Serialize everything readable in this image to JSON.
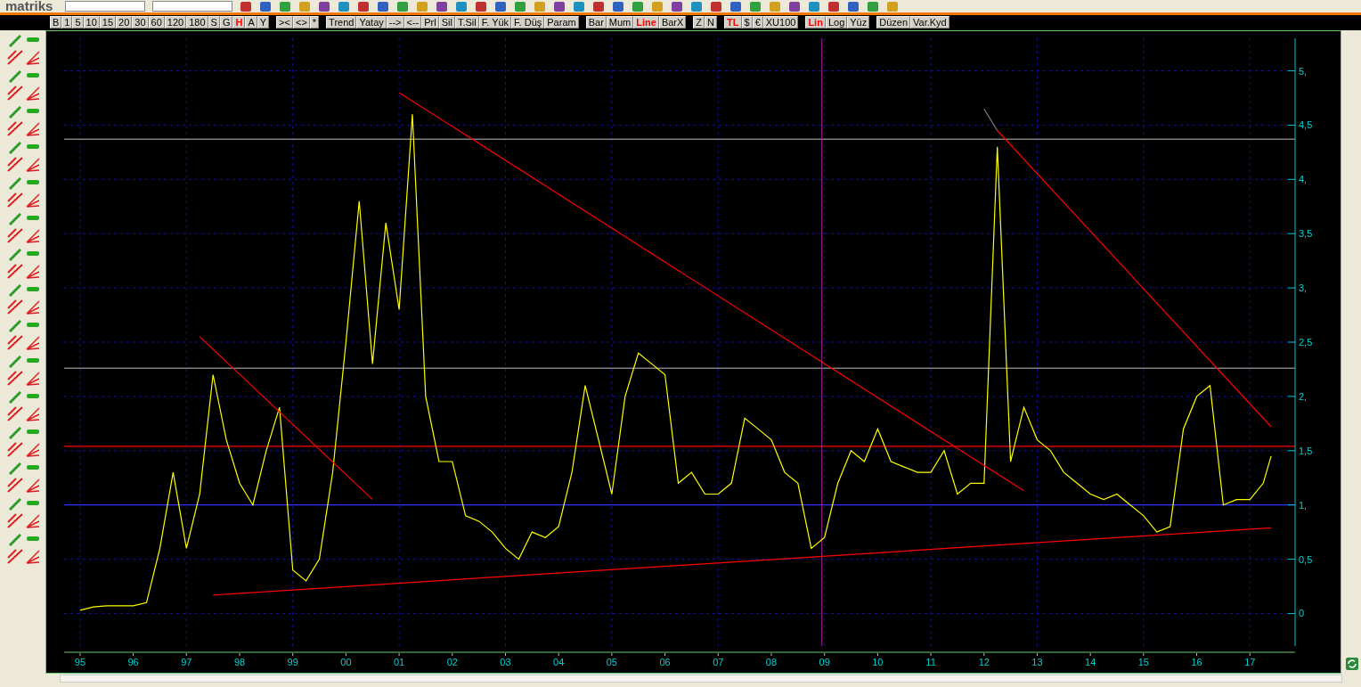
{
  "app": {
    "logo": "matriks"
  },
  "button_groups": [
    {
      "buttons": [
        {
          "label": "B",
          "selected": false
        },
        {
          "label": "1",
          "selected": false
        },
        {
          "label": "5",
          "selected": false
        },
        {
          "label": "10",
          "selected": false
        },
        {
          "label": "15",
          "selected": false
        },
        {
          "label": "20",
          "selected": false
        },
        {
          "label": "30",
          "selected": false
        },
        {
          "label": "60",
          "selected": false
        },
        {
          "label": "120",
          "selected": false
        },
        {
          "label": "180",
          "selected": false
        },
        {
          "label": "S",
          "selected": false
        },
        {
          "label": "G",
          "selected": false
        },
        {
          "label": "H",
          "selected": true
        },
        {
          "label": "A",
          "selected": false
        },
        {
          "label": "Y",
          "selected": false
        }
      ]
    },
    {
      "buttons": [
        {
          "label": "><",
          "selected": false
        },
        {
          "label": "<>",
          "selected": false
        },
        {
          "label": "*",
          "selected": false
        }
      ]
    },
    {
      "buttons": [
        {
          "label": "Trend",
          "selected": false
        },
        {
          "label": "Yatay",
          "selected": false
        },
        {
          "label": "-->",
          "selected": false
        },
        {
          "label": "<--",
          "selected": false
        },
        {
          "label": "Prl",
          "selected": false
        },
        {
          "label": "Sil",
          "selected": false
        },
        {
          "label": "T.Sil",
          "selected": false
        },
        {
          "label": "F. Yük",
          "selected": false
        },
        {
          "label": "F. Düş",
          "selected": false
        },
        {
          "label": "Param",
          "selected": false
        }
      ]
    },
    {
      "buttons": [
        {
          "label": "Bar",
          "selected": false
        },
        {
          "label": "Mum",
          "selected": false
        },
        {
          "label": "Line",
          "selected": true
        },
        {
          "label": "BarX",
          "selected": false
        }
      ]
    },
    {
      "buttons": [
        {
          "label": "Z",
          "selected": false
        },
        {
          "label": "N",
          "selected": false
        }
      ]
    },
    {
      "buttons": [
        {
          "label": "TL",
          "selected": true
        },
        {
          "label": "$",
          "selected": false
        },
        {
          "label": "€",
          "selected": false
        },
        {
          "label": "XU100",
          "selected": false
        }
      ]
    },
    {
      "buttons": [
        {
          "label": "Lin",
          "selected": true
        },
        {
          "label": "Log",
          "selected": false
        },
        {
          "label": "Yüz",
          "selected": false
        }
      ]
    },
    {
      "buttons": [
        {
          "label": "Düzen",
          "selected": false
        },
        {
          "label": "Var.Kyd",
          "selected": false
        }
      ]
    }
  ],
  "chart": {
    "chart_data": {
      "type": "line",
      "x": [
        1995,
        1995.25,
        1995.5,
        1995.75,
        1996,
        1996.25,
        1996.5,
        1996.75,
        1997,
        1997.25,
        1997.5,
        1997.75,
        1998,
        1998.25,
        1998.5,
        1998.75,
        1999,
        1999.25,
        1999.5,
        1999.75,
        2000,
        2000.25,
        2000.5,
        2000.75,
        2001,
        2001.25,
        2001.5,
        2001.75,
        2002,
        2002.25,
        2002.5,
        2002.75,
        2003,
        2003.25,
        2003.5,
        2003.75,
        2004,
        2004.25,
        2004.5,
        2004.75,
        2005,
        2005.25,
        2005.5,
        2005.75,
        2006,
        2006.25,
        2006.5,
        2006.75,
        2007,
        2007.25,
        2007.5,
        2007.75,
        2008,
        2008.25,
        2008.5,
        2008.75,
        2009,
        2009.25,
        2009.5,
        2009.75,
        2010,
        2010.25,
        2010.5,
        2010.75,
        2011,
        2011.25,
        2011.5,
        2011.75,
        2012,
        2012.25,
        2012.5,
        2012.75,
        2013,
        2013.25,
        2013.5,
        2013.75,
        2014,
        2014.25,
        2014.5,
        2014.75,
        2015,
        2015.25,
        2015.5,
        2015.75,
        2016,
        2016.25,
        2016.5,
        2016.75,
        2017,
        2017.25,
        2017.4
      ],
      "series": [
        {
          "color": "#ffff00",
          "values": [
            0.03,
            0.06,
            0.07,
            0.07,
            0.07,
            0.1,
            0.6,
            1.3,
            0.6,
            1.1,
            2.2,
            1.6,
            1.2,
            1.0,
            1.5,
            1.9,
            0.4,
            0.3,
            0.5,
            1.3,
            2.5,
            3.8,
            2.3,
            3.6,
            2.8,
            4.6,
            2.0,
            1.4,
            1.4,
            0.9,
            0.85,
            0.75,
            0.6,
            0.5,
            0.75,
            0.7,
            0.8,
            1.3,
            2.1,
            1.6,
            1.1,
            2.0,
            2.4,
            2.3,
            2.2,
            1.2,
            1.3,
            1.1,
            1.1,
            1.2,
            1.8,
            1.7,
            1.6,
            1.3,
            1.2,
            0.6,
            0.7,
            1.2,
            1.5,
            1.4,
            1.7,
            1.4,
            1.35,
            1.3,
            1.3,
            1.5,
            1.1,
            1.2,
            1.2,
            4.3,
            1.4,
            1.9,
            1.6,
            1.5,
            1.3,
            1.2,
            1.1,
            1.05,
            1.1,
            1.0,
            0.9,
            0.75,
            0.8,
            1.7,
            2.0,
            2.1,
            1.0,
            1.05,
            1.05,
            1.2,
            1.45
          ]
        },
        {
          "color": "#ff0000",
          "values": [
            null,
            null,
            null,
            null,
            null,
            null,
            null,
            null,
            null,
            2.55,
            null,
            null,
            null,
            null,
            null,
            null,
            null,
            null,
            null,
            null,
            null,
            null,
            1.05,
            null,
            null,
            null,
            null,
            null,
            null,
            null,
            null,
            null,
            null,
            null,
            null,
            null,
            null,
            null,
            null,
            null,
            null,
            null,
            null,
            null,
            null,
            null,
            null,
            null,
            null,
            null,
            null,
            null,
            null,
            null,
            null,
            null,
            null,
            null,
            null,
            null,
            null,
            null,
            null,
            null,
            null,
            null,
            null,
            null,
            null,
            null,
            null,
            null,
            null,
            null,
            null,
            null,
            null,
            null,
            null,
            null,
            null,
            null,
            null,
            null,
            null,
            null,
            null,
            null,
            null,
            null,
            null
          ]
        },
        {
          "color": "#ff0000",
          "values": [
            null,
            null,
            null,
            null,
            null,
            null,
            null,
            null,
            null,
            null,
            null,
            null,
            null,
            null,
            null,
            null,
            null,
            null,
            null,
            null,
            null,
            null,
            null,
            null,
            4.8,
            null,
            null,
            null,
            null,
            null,
            null,
            null,
            null,
            null,
            null,
            null,
            null,
            null,
            null,
            null,
            null,
            null,
            null,
            null,
            null,
            null,
            null,
            null,
            null,
            null,
            null,
            null,
            null,
            null,
            null,
            null,
            null,
            null,
            null,
            null,
            null,
            null,
            null,
            null,
            null,
            null,
            null,
            null,
            null,
            null,
            null,
            1.13,
            null,
            null,
            null,
            null,
            null,
            null,
            null,
            null,
            null,
            null,
            null,
            null,
            null,
            null,
            null,
            null,
            null,
            null,
            null
          ]
        },
        {
          "color": "#ff0000",
          "values": [
            null,
            null,
            null,
            null,
            null,
            null,
            null,
            null,
            null,
            null,
            0.17,
            null,
            null,
            null,
            null,
            null,
            null,
            null,
            null,
            null,
            null,
            null,
            null,
            null,
            null,
            null,
            null,
            null,
            null,
            null,
            null,
            null,
            null,
            null,
            null,
            null,
            null,
            null,
            null,
            null,
            null,
            null,
            null,
            null,
            null,
            null,
            null,
            null,
            null,
            null,
            null,
            null,
            null,
            null,
            null,
            null,
            null,
            null,
            null,
            null,
            null,
            null,
            null,
            null,
            null,
            null,
            null,
            null,
            null,
            null,
            null,
            null,
            null,
            null,
            null,
            null,
            null,
            null,
            null,
            null,
            null,
            null,
            null,
            null,
            null,
            null,
            null,
            null,
            null,
            null,
            0.79
          ]
        },
        {
          "color": "#808080",
          "values": [
            null,
            null,
            null,
            null,
            null,
            null,
            null,
            null,
            null,
            null,
            null,
            null,
            null,
            null,
            null,
            null,
            null,
            null,
            null,
            null,
            null,
            null,
            null,
            null,
            null,
            null,
            null,
            null,
            null,
            null,
            null,
            null,
            null,
            null,
            null,
            null,
            null,
            null,
            null,
            null,
            null,
            null,
            null,
            null,
            null,
            null,
            null,
            null,
            null,
            null,
            null,
            null,
            null,
            null,
            null,
            null,
            null,
            null,
            null,
            null,
            null,
            null,
            null,
            null,
            null,
            null,
            null,
            null,
            4.65,
            4.45,
            null,
            null,
            null,
            null,
            null,
            null,
            null,
            null,
            null,
            null,
            null,
            null,
            null,
            null,
            null,
            null,
            null,
            null,
            null,
            null,
            null
          ]
        },
        {
          "color": "#ff0000",
          "values": [
            null,
            null,
            null,
            null,
            null,
            null,
            null,
            null,
            null,
            null,
            null,
            null,
            null,
            null,
            null,
            null,
            null,
            null,
            null,
            null,
            null,
            null,
            null,
            null,
            null,
            null,
            null,
            null,
            null,
            null,
            null,
            null,
            null,
            null,
            null,
            null,
            null,
            null,
            null,
            null,
            null,
            null,
            null,
            null,
            null,
            null,
            null,
            null,
            null,
            null,
            null,
            null,
            null,
            null,
            null,
            null,
            null,
            null,
            null,
            null,
            null,
            null,
            null,
            null,
            null,
            null,
            null,
            null,
            null,
            4.45,
            null,
            null,
            null,
            null,
            null,
            null,
            null,
            null,
            null,
            null,
            null,
            null,
            null,
            null,
            null,
            null,
            null,
            null,
            null,
            null,
            1.72
          ]
        }
      ],
      "grid": true,
      "xlim": [
        1994.7,
        2017.85
      ],
      "ylim": [
        -0.3,
        5.3
      ],
      "xticks": [
        {
          "value": 1995,
          "label": "95"
        },
        {
          "value": 1996,
          "label": "96"
        },
        {
          "value": 1997,
          "label": "97"
        },
        {
          "value": 1998,
          "label": "98"
        },
        {
          "value": 1999,
          "label": "99"
        },
        {
          "value": 2000,
          "label": "00"
        },
        {
          "value": 2001,
          "label": "01"
        },
        {
          "value": 2002,
          "label": "02"
        },
        {
          "value": 2003,
          "label": "03"
        },
        {
          "value": 2004,
          "label": "04"
        },
        {
          "value": 2005,
          "label": "05"
        },
        {
          "value": 2006,
          "label": "06"
        },
        {
          "value": 2007,
          "label": "07"
        },
        {
          "value": 2008,
          "label": "08"
        },
        {
          "value": 2009,
          "label": "09"
        },
        {
          "value": 2010,
          "label": "10"
        },
        {
          "value": 2011,
          "label": "11"
        },
        {
          "value": 2012,
          "label": "12"
        },
        {
          "value": 2013,
          "label": "13"
        },
        {
          "value": 2014,
          "label": "14"
        },
        {
          "value": 2015,
          "label": "15"
        },
        {
          "value": 2016,
          "label": "16"
        },
        {
          "value": 2017,
          "label": "17"
        }
      ],
      "yticks": [
        {
          "value": 5,
          "label": "5,"
        },
        {
          "value": 4.5,
          "label": "4,5"
        },
        {
          "value": 4,
          "label": "4,"
        },
        {
          "value": 3.5,
          "label": "3,5"
        },
        {
          "value": 3,
          "label": "3,"
        },
        {
          "value": 2.5,
          "label": "2,5"
        },
        {
          "value": 2,
          "label": "2,"
        },
        {
          "value": 1.5,
          "label": "1,5"
        },
        {
          "value": 1,
          "label": "1,"
        },
        {
          "value": 0.5,
          "label": "0,5"
        },
        {
          "value": 0,
          "label": "0"
        }
      ],
      "ref_lines": [
        {
          "axis": "y",
          "value": 4.37,
          "color": "#808080"
        },
        {
          "axis": "y",
          "value": 2.26,
          "color": "#808080"
        },
        {
          "axis": "y",
          "value": 1.54,
          "color": "#ff0000"
        },
        {
          "axis": "y",
          "value": 1.0,
          "color": "#3030ff"
        },
        {
          "axis": "x",
          "value": 2008.95,
          "color": "#a020a0"
        }
      ]
    }
  }
}
